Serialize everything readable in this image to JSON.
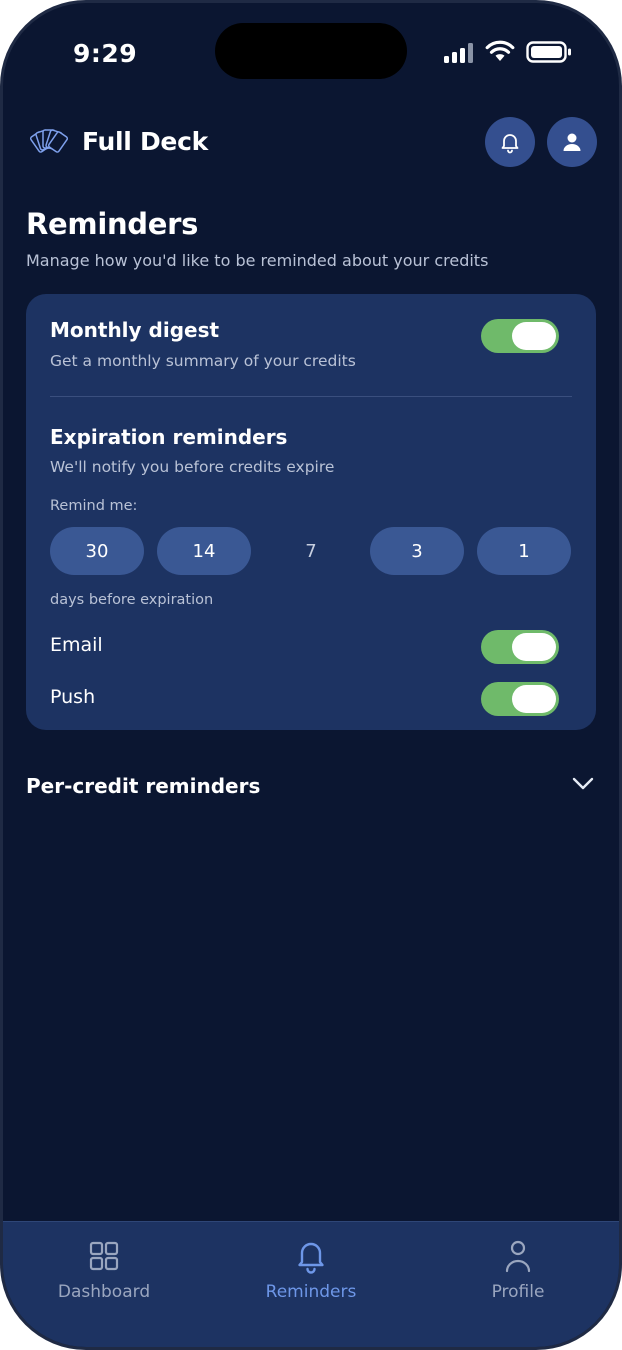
{
  "status_bar": {
    "time": "9:29"
  },
  "header": {
    "app_name": "Full Deck"
  },
  "page": {
    "title": "Reminders",
    "subtitle": "Manage how you'd like to be reminded about your credits"
  },
  "settings": {
    "monthly_digest": {
      "title": "Monthly digest",
      "description": "Get a monthly summary of your credits",
      "enabled": true
    },
    "expiration": {
      "title": "Expiration reminders",
      "description": "We'll notify you before credits expire",
      "remind_label": "Remind me:",
      "options": [
        "30",
        "14",
        "7",
        "3",
        "1"
      ],
      "selected": [
        "30",
        "14",
        "3",
        "1"
      ],
      "days_label": "days before expiration"
    },
    "channels": {
      "email": {
        "label": "Email",
        "enabled": true
      },
      "push": {
        "label": "Push",
        "enabled": true
      }
    }
  },
  "per_credit": {
    "label": "Per-credit reminders"
  },
  "tabs": [
    {
      "label": "Dashboard",
      "icon": "grid-icon"
    },
    {
      "label": "Reminders",
      "icon": "bell-icon",
      "active": true
    },
    {
      "label": "Profile",
      "icon": "person-icon"
    }
  ],
  "colors": {
    "background": "#0b1631",
    "card": "#1d3362",
    "pill": "#3a5894",
    "toggle_on": "#6fba6a",
    "accent": "#6e97e8"
  }
}
